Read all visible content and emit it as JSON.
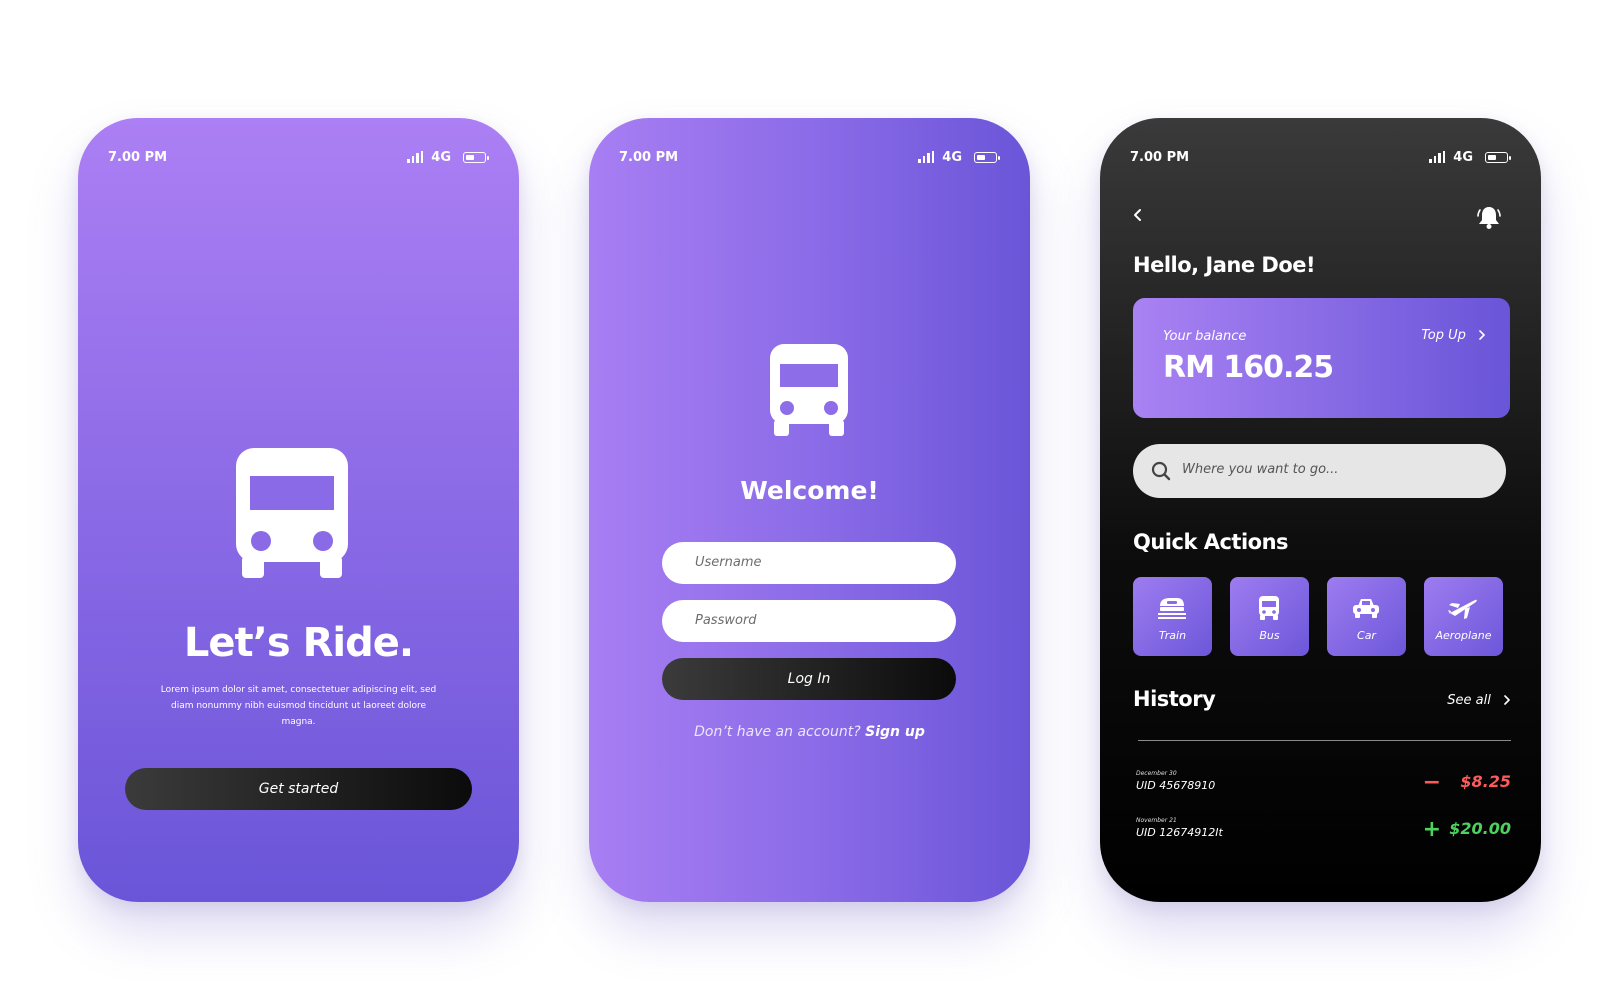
{
  "status_bar": {
    "time": "7.00 PM",
    "network": "4G"
  },
  "screen1": {
    "title": "Let’s Ride.",
    "body_text": "Lorem ipsum dolor sit amet, consectetuer adipiscing elit, sed diam nonummy nibh euismod tincidunt ut laoreet dolore magna.",
    "cta_label": "Get started"
  },
  "screen2": {
    "title": "Welcome!",
    "username_placeholder": "Username",
    "password_placeholder": "Password",
    "login_label": "Log In",
    "signup_prompt": "Don’t have an account?",
    "signup_link": "Sign up"
  },
  "screen3": {
    "greeting": "Hello, Jane Doe!",
    "balance": {
      "label": "Your balance",
      "amount": "RM 160.25",
      "topup_label": "Top Up"
    },
    "search_placeholder": "Where you want to go...",
    "quick_actions": {
      "title": "Quick Actions",
      "items": [
        {
          "label": "Train",
          "icon": "train-icon"
        },
        {
          "label": "Bus",
          "icon": "bus-icon"
        },
        {
          "label": "Car",
          "icon": "car-icon"
        },
        {
          "label": "Aeroplane",
          "icon": "aeroplane-icon"
        }
      ]
    },
    "history": {
      "title": "History",
      "see_all": "See all",
      "entries": [
        {
          "date": "December 30",
          "uid": "UID 45678910",
          "sign": "−",
          "amount": "$8.25",
          "color": "#ff5a5a"
        },
        {
          "date": "November 21",
          "uid": "UID 12674912It",
          "sign": "+",
          "amount": "$20.00",
          "color": "#4ed25e"
        }
      ]
    }
  },
  "colors": {
    "accent_light": "#ac7ff4",
    "accent_dark": "#6a55d8",
    "debit": "#ff5a5a",
    "credit": "#4ed25e"
  }
}
